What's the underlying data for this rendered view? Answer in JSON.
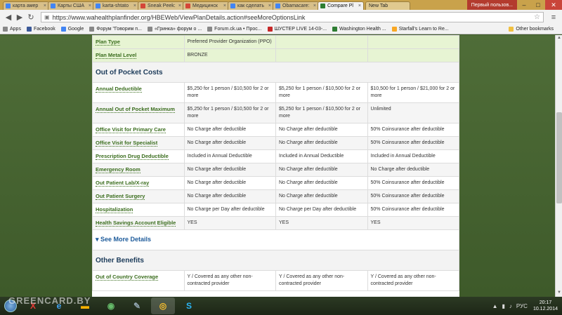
{
  "browser": {
    "tabs": [
      {
        "label": "карта амер",
        "color": "#4285f4",
        "active": false
      },
      {
        "label": "Карты США",
        "color": "#4285f4",
        "active": false
      },
      {
        "label": "karta-shtato",
        "color": "#4285f4",
        "active": false
      },
      {
        "label": "Sneak Peek:",
        "color": "#d44638",
        "active": false
      },
      {
        "label": "Медицинск",
        "color": "#d44638",
        "active": false
      },
      {
        "label": "как сделать",
        "color": "#4285f4",
        "active": false
      },
      {
        "label": "Obamacare:",
        "color": "#4285f4",
        "active": false
      },
      {
        "label": "Compare Pl",
        "color": "#2e7d32",
        "active": true
      }
    ],
    "new_tab_label": "New Tab",
    "notice": "Первый пользов...",
    "url": "https://www.wahealthplanfinder.org/HBEWeb/ViewPlanDetails.action#seeMoreOptionsLink",
    "bookmarks": [
      {
        "label": "Apps",
        "color": "#888"
      },
      {
        "label": "Facebook",
        "color": "#3b5998"
      },
      {
        "label": "Google",
        "color": "#4285f4"
      },
      {
        "label": "Форум \"Говорим п...",
        "color": "#888"
      },
      {
        "label": "«Гринка» форум о ...",
        "color": "#888"
      },
      {
        "label": "Forum.ck.ua • Прос...",
        "color": "#888"
      },
      {
        "label": "ШУСТЕР LIVE 14-03-...",
        "color": "#c62828"
      },
      {
        "label": "Washington Health ...",
        "color": "#2e7d32"
      },
      {
        "label": "Starfall's Learn to Re...",
        "color": "#f9a825"
      }
    ],
    "other_bookmarks": "Other bookmarks"
  },
  "plan": {
    "top_rows": [
      {
        "label": "Plan Type",
        "values": [
          "Preferred Provider Organization (PPO)",
          "",
          ""
        ]
      },
      {
        "label": "Plan Metal Level",
        "values": [
          "BRONZE",
          "",
          ""
        ]
      }
    ],
    "oop_title": "Out of Pocket Costs",
    "oop_rows": [
      {
        "label": "Annual Deductible",
        "values": [
          "$5,250 for 1 person / $10,500 for 2 or more",
          "$5,250 for 1 person / $10,500 for 2 or more",
          "$10,500 for 1 person / $21,000 for 2 or more"
        ]
      },
      {
        "label": "Annual Out of Pocket Maximum",
        "values": [
          "$5,250 for 1 person / $10,500 for 2 or more",
          "$5,250 for 1 person / $10,500 for 2 or more",
          "Unlimited"
        ]
      },
      {
        "label": "Office Visit for Primary Care",
        "values": [
          "No Charge after deductible",
          "No Charge after deductible",
          "50% Coinsurance after deductible"
        ]
      },
      {
        "label": "Office Visit for Specialist",
        "values": [
          "No Charge after deductible",
          "No Charge after deductible",
          "50% Coinsurance after deductible"
        ]
      },
      {
        "label": "Prescription Drug Deductible",
        "values": [
          "Included in Annual Deductible",
          "Included in Annual Deductible",
          "Included in Annual Deductible"
        ]
      },
      {
        "label": "Emergency Room",
        "values": [
          "No Charge after deductible",
          "No Charge after deductible",
          "No Charge after deductible"
        ]
      },
      {
        "label": "Out Patient Lab/X-ray",
        "values": [
          "No Charge after deductible",
          "No Charge after deductible",
          "50% Coinsurance after deductible"
        ]
      },
      {
        "label": "Out Patient Surgery",
        "values": [
          "No Charge after deductible",
          "No Charge after deductible",
          "50% Coinsurance after deductible"
        ]
      },
      {
        "label": "Hospitalization",
        "values": [
          "No Charge per Day after deductible",
          "No Charge per Day after deductible",
          "50% Coinsurance after deductible"
        ]
      },
      {
        "label": "Health Savings Account Eligible",
        "values": [
          "YES",
          "YES",
          "YES"
        ]
      }
    ],
    "see_more": "See More Details",
    "other_title": "Other Benefits",
    "other_rows": [
      {
        "label": "Out of Country Coverage",
        "values": [
          "Y / Covered as any other non-contracted provider",
          "Y / Covered as any other non-contracted provider",
          "Y / Covered as any other non-contracted provider"
        ]
      }
    ]
  },
  "taskbar": {
    "watermark": "GREENCARD.BY",
    "language": "РУС",
    "time": "20:17",
    "date": "10.12.2014"
  }
}
